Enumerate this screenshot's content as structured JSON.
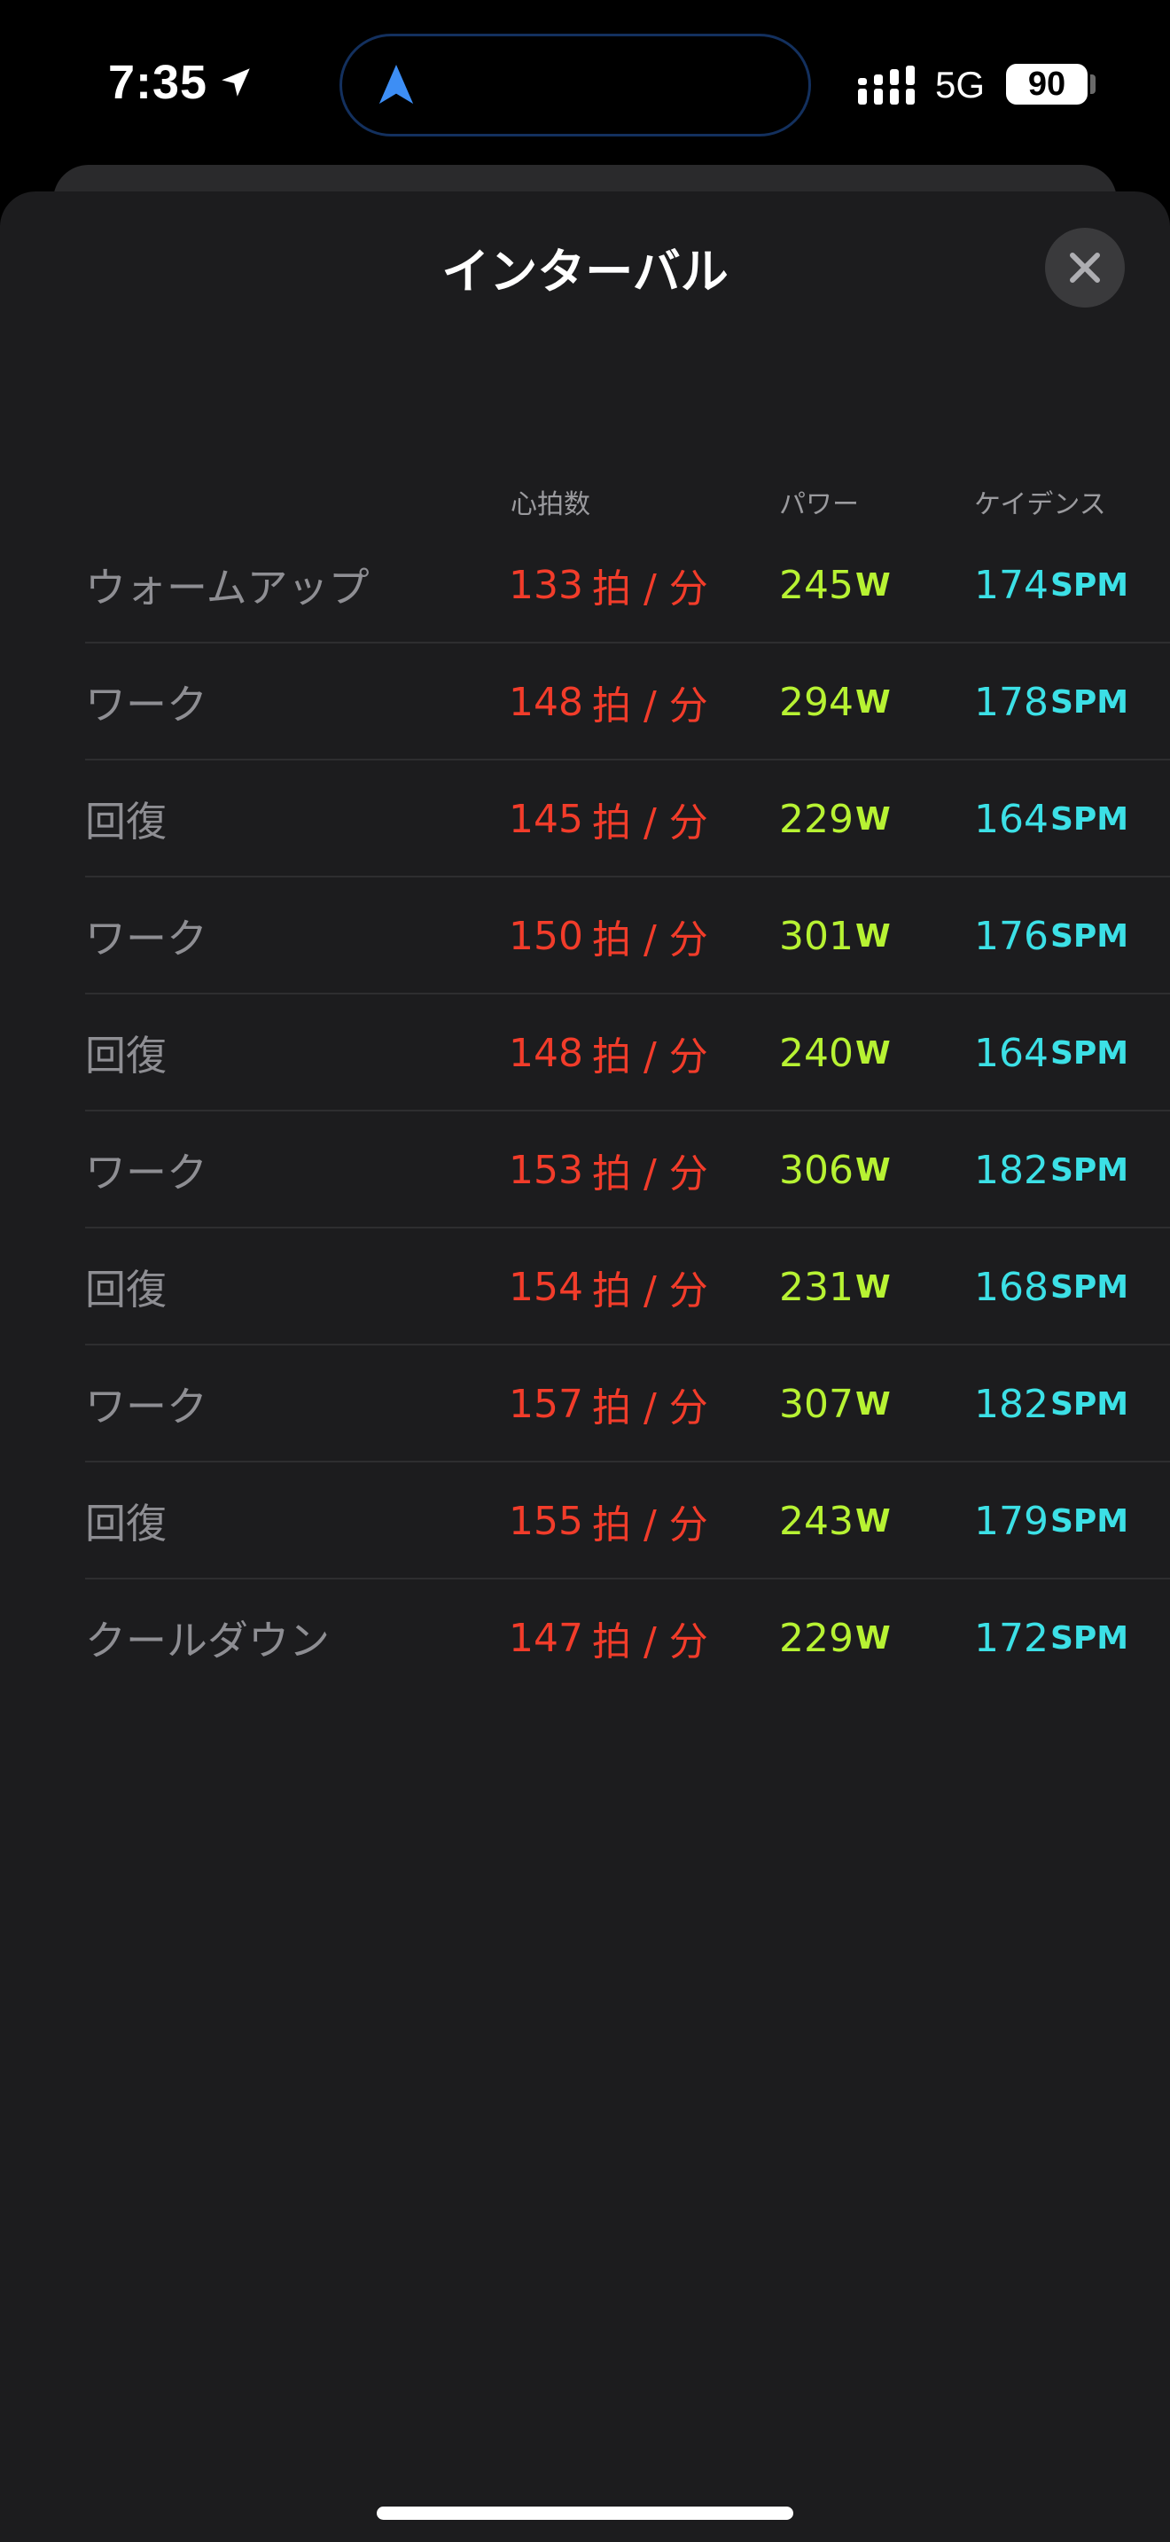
{
  "status_bar": {
    "time": "7:35",
    "network": "5G",
    "battery": "90"
  },
  "sheet": {
    "title": "インターバル"
  },
  "columns": {
    "hr": "心拍数",
    "power": "パワー",
    "cadence": "ケイデンス"
  },
  "units": {
    "hr": "拍 / 分",
    "power": "W",
    "cadence": "SPM"
  },
  "rows": [
    {
      "phase": "ウォームアップ",
      "hr": "133",
      "power": "245",
      "cadence": "174"
    },
    {
      "phase": "ワーク",
      "hr": "148",
      "power": "294",
      "cadence": "178"
    },
    {
      "phase": "回復",
      "hr": "145",
      "power": "229",
      "cadence": "164"
    },
    {
      "phase": "ワーク",
      "hr": "150",
      "power": "301",
      "cadence": "176"
    },
    {
      "phase": "回復",
      "hr": "148",
      "power": "240",
      "cadence": "164"
    },
    {
      "phase": "ワーク",
      "hr": "153",
      "power": "306",
      "cadence": "182"
    },
    {
      "phase": "回復",
      "hr": "154",
      "power": "231",
      "cadence": "168"
    },
    {
      "phase": "ワーク",
      "hr": "157",
      "power": "307",
      "cadence": "182"
    },
    {
      "phase": "回復",
      "hr": "155",
      "power": "243",
      "cadence": "179"
    },
    {
      "phase": "クールダウン",
      "hr": "147",
      "power": "229",
      "cadence": "172"
    }
  ],
  "colors": {
    "background": "#1c1c1e",
    "heart_rate": "#f23c2a",
    "power": "#b7f233",
    "cadence": "#3ce0e6",
    "phase_label": "#8e8e93",
    "header": "#9a9a9e"
  },
  "icons": {
    "location": "location-arrow-icon",
    "navigation": "navigation-arrow-icon",
    "signal": "cellular-signal-icon",
    "close": "close-icon"
  }
}
